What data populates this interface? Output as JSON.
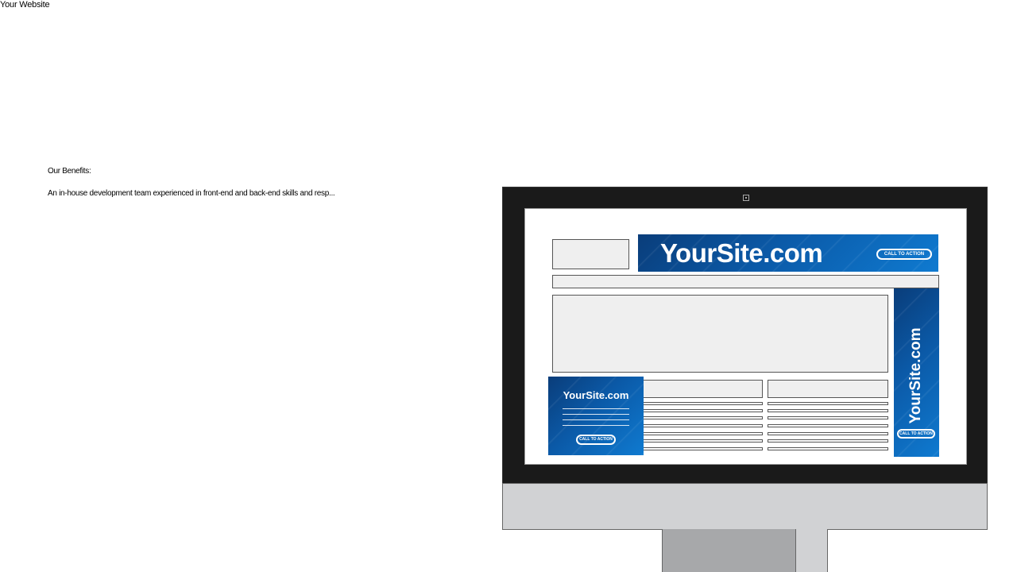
{
  "header": {
    "site_title": "Your Website"
  },
  "benefits": {
    "heading": "Our Benefits:",
    "text": "An in-house development team experienced in front-end and back-end skills and resp..."
  },
  "illustration": {
    "ads": {
      "leaderboard": {
        "brand": "YourSite.com",
        "cta": "CALL TO ACTION"
      },
      "square": {
        "brand": "YourSite.com",
        "cta": "CALL TO ACTION"
      },
      "skyscraper": {
        "brand": "YourSite.com",
        "cta": "CALL TO ACTION"
      }
    },
    "colors": {
      "ad_blue": "#0b5aa8",
      "bezel": "#1a1a1a",
      "chin": "#d1d2d4",
      "stand": "#a7a8aa"
    }
  }
}
